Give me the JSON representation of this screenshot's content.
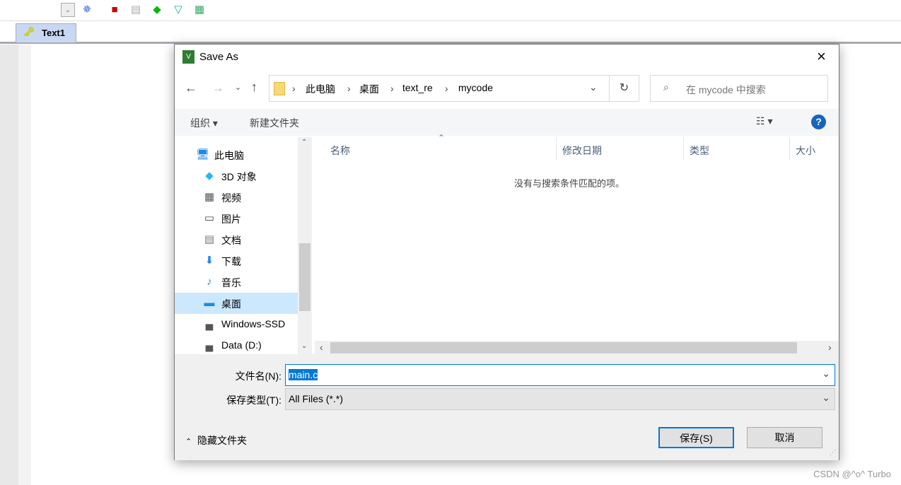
{
  "app": {
    "tab_label": "Text1",
    "toolbar_icons": [
      "dropdown-icon",
      "wizard-icon",
      "blocks-icon",
      "windows-icon",
      "diamond-icon",
      "filter-icon",
      "tiles-icon"
    ]
  },
  "dialog": {
    "title": "Save As",
    "breadcrumb": [
      "此电脑",
      "桌面",
      "text_re",
      "mycode"
    ],
    "search_placeholder": "在 mycode 中搜索",
    "organize": "组织",
    "new_folder": "新建文件夹",
    "help": "?",
    "nav": [
      {
        "label": "此电脑",
        "icon": "computer-icon"
      },
      {
        "label": "3D 对象",
        "icon": "cube-icon"
      },
      {
        "label": "视频",
        "icon": "video-icon"
      },
      {
        "label": "图片",
        "icon": "picture-icon"
      },
      {
        "label": "文档",
        "icon": "document-icon"
      },
      {
        "label": "下载",
        "icon": "download-icon"
      },
      {
        "label": "音乐",
        "icon": "music-icon"
      },
      {
        "label": "桌面",
        "icon": "desktop-icon",
        "selected": true
      },
      {
        "label": "Windows-SSD",
        "icon": "drive-icon"
      },
      {
        "label": "Data (D:)",
        "icon": "drive-icon"
      }
    ],
    "columns": [
      "名称",
      "修改日期",
      "类型",
      "大小"
    ],
    "empty_message": "没有与搜索条件匹配的项。",
    "filename_label": "文件名(N):",
    "filename_value": "main.c",
    "filetype_label": "保存类型(T):",
    "filetype_value": "All Files (*.*)",
    "hide_folders": "隐藏文件夹",
    "save": "保存(S)",
    "cancel": "取消"
  },
  "watermark": "CSDN @^o^ Turbo"
}
